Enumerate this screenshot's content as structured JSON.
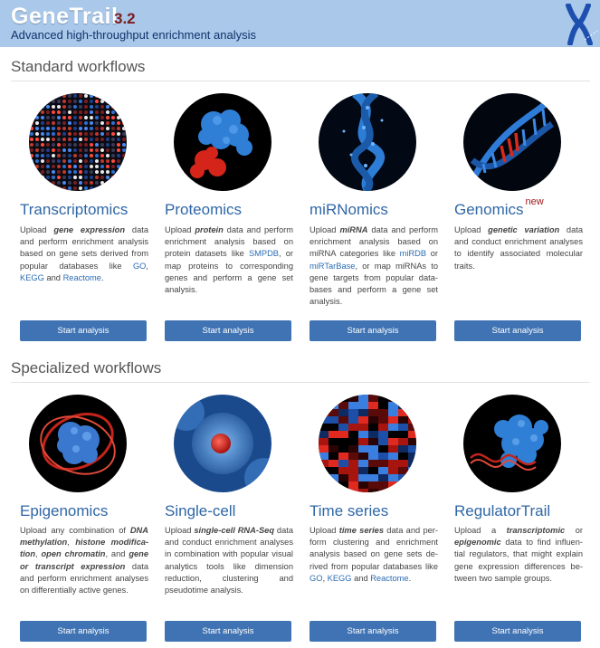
{
  "header": {
    "logo": "GeneTrail",
    "version": "3.2",
    "tagline": "Advanced high-throughput enrichment analysis",
    "bg_color": "#a9c8ea"
  },
  "sections": {
    "standard": {
      "title": "Standard workflows"
    },
    "specialized": {
      "title": "Specialized workflows"
    }
  },
  "cards": {
    "transcriptomics": {
      "title": "Transcriptomics",
      "desc": [
        "Upload ",
        {
          "bi": "gene expression"
        },
        " data and perform enrichment analysis based on gene sets derived from popular databases like ",
        {
          "a": "GO"
        },
        ", ",
        {
          "a": "KEGG"
        },
        " and ",
        {
          "a": "Reactome"
        },
        "."
      ],
      "button": "Start analysis",
      "image_icon": "microarray-image"
    },
    "proteomics": {
      "title": "Proteomics",
      "desc": [
        "Upload ",
        {
          "bi": "protein"
        },
        " data and perform enrichment analysis based on protein datasets like ",
        {
          "a": "SMPDB"
        },
        ", or map proteins to corresponding genes and perform a gene set analysis."
      ],
      "button": "Start analysis",
      "image_icon": "protein-structure-image"
    },
    "mirnomics": {
      "title": "miRNomics",
      "desc": [
        "Upload ",
        {
          "bi": "miRNA"
        },
        " data and perform enrichment analysis based on miRNA categories like ",
        {
          "a": "miRDB"
        },
        " or ",
        {
          "a": "miRTarBase"
        },
        ", or map miRNAs to gene targets from popular data-bases and perform a gene set analysis."
      ],
      "button": "Start analysis",
      "image_icon": "rna-helix-image"
    },
    "genomics": {
      "title": "Genomics",
      "badge": "new",
      "desc": [
        "Upload ",
        {
          "bi": "genetic variation"
        },
        " data and conduct enrichment analyses to identify associated molecular traits."
      ],
      "button": "Start analysis",
      "image_icon": "dna-helix-image"
    },
    "epigenomics": {
      "title": "Epigenomics",
      "desc": [
        "Upload any combination of ",
        {
          "bi": "DNA methylation"
        },
        ", ",
        {
          "bi": "histone modifica-tion"
        },
        ", ",
        {
          "bi": "open chromatin"
        },
        ", and ",
        {
          "bi": "gene or transcript expression"
        },
        " data and perform enrichment analyses on differentially active genes."
      ],
      "button": "Start analysis",
      "image_icon": "nucleosome-image"
    },
    "singlecell": {
      "title": "Single-cell",
      "desc": [
        "Upload ",
        {
          "bi": "single-cell RNA-Seq"
        },
        " data and conduct enrichment analyses in combination with popular visual analytics tools like dimension reduction, clustering and pseudotime analysis."
      ],
      "button": "Start analysis",
      "image_icon": "cell-image"
    },
    "timeseries": {
      "title": "Time series",
      "desc": [
        "Upload ",
        {
          "bi": "time series"
        },
        " data and per-form clustering and enrichment analysis based on gene sets de-rived from popular databases like ",
        {
          "a": "GO"
        },
        ", ",
        {
          "a": "KEGG"
        },
        " and ",
        {
          "a": "Reactome"
        },
        "."
      ],
      "button": "Start analysis",
      "image_icon": "heatmap-image"
    },
    "regulatortrail": {
      "title": "RegulatorTrail",
      "desc": [
        "Upload a ",
        {
          "bi": "transcriptomic"
        },
        " or ",
        {
          "bi": "epigenomic"
        },
        " data to find influen-tial regulators, that might explain gene expression differences be-tween two sample groups."
      ],
      "button": "Start analysis",
      "image_icon": "protein-dna-complex-image"
    }
  },
  "colors": {
    "title": "#2f67a6",
    "button": "#3f73b3",
    "link": "#2d6cb3",
    "badge": "#a01818"
  }
}
